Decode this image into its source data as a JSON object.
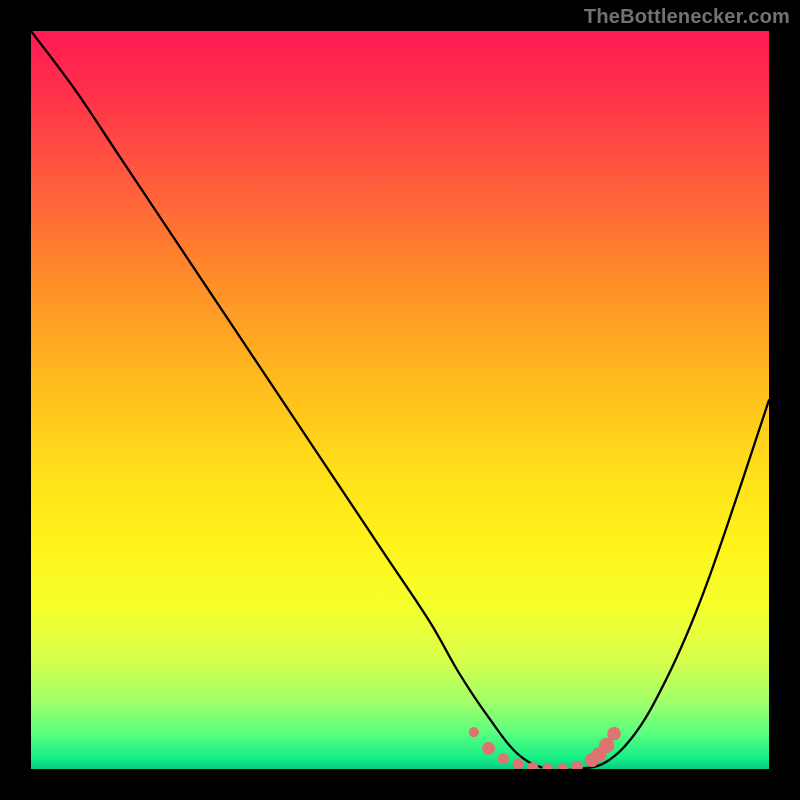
{
  "attribution": "TheBottlenecker.com",
  "chart_data": {
    "type": "line",
    "title": "",
    "xlabel": "",
    "ylabel": "",
    "xlim": [
      0,
      100
    ],
    "ylim": [
      0,
      100
    ],
    "series": [
      {
        "name": "curve",
        "x": [
          0,
          6,
          12,
          18,
          24,
          30,
          36,
          42,
          48,
          54,
          58,
          62,
          66,
          70,
          74,
          78,
          82,
          86,
          90,
          94,
          100
        ],
        "y": [
          100,
          92,
          83,
          74,
          65,
          56,
          47,
          38,
          29,
          20,
          13,
          7,
          2,
          0,
          0,
          1,
          5,
          12,
          21,
          32,
          50
        ],
        "color": "#000000"
      }
    ],
    "markers": {
      "name": "highlight",
      "color": "#de7372",
      "points": [
        {
          "x": 60,
          "y": 5.0,
          "r": 3.2
        },
        {
          "x": 62,
          "y": 2.8,
          "r": 4.0
        },
        {
          "x": 64,
          "y": 1.4,
          "r": 3.4
        },
        {
          "x": 66,
          "y": 0.7,
          "r": 3.4
        },
        {
          "x": 68,
          "y": 0.2,
          "r": 3.4
        },
        {
          "x": 70,
          "y": 0.0,
          "r": 3.4
        },
        {
          "x": 72,
          "y": 0.0,
          "r": 3.4
        },
        {
          "x": 74,
          "y": 0.3,
          "r": 3.6
        },
        {
          "x": 76,
          "y": 1.2,
          "r": 4.4
        },
        {
          "x": 77,
          "y": 2.0,
          "r": 4.6
        },
        {
          "x": 78,
          "y": 3.2,
          "r": 4.8
        },
        {
          "x": 79,
          "y": 4.8,
          "r": 4.2
        }
      ]
    },
    "background_gradient": {
      "type": "vertical",
      "stops": [
        {
          "pos": 0.0,
          "color": "#ff1a52"
        },
        {
          "pos": 0.5,
          "color": "#ffd21a"
        },
        {
          "pos": 0.9,
          "color": "#c8ff50"
        },
        {
          "pos": 1.0,
          "color": "#0acb84"
        }
      ]
    }
  }
}
